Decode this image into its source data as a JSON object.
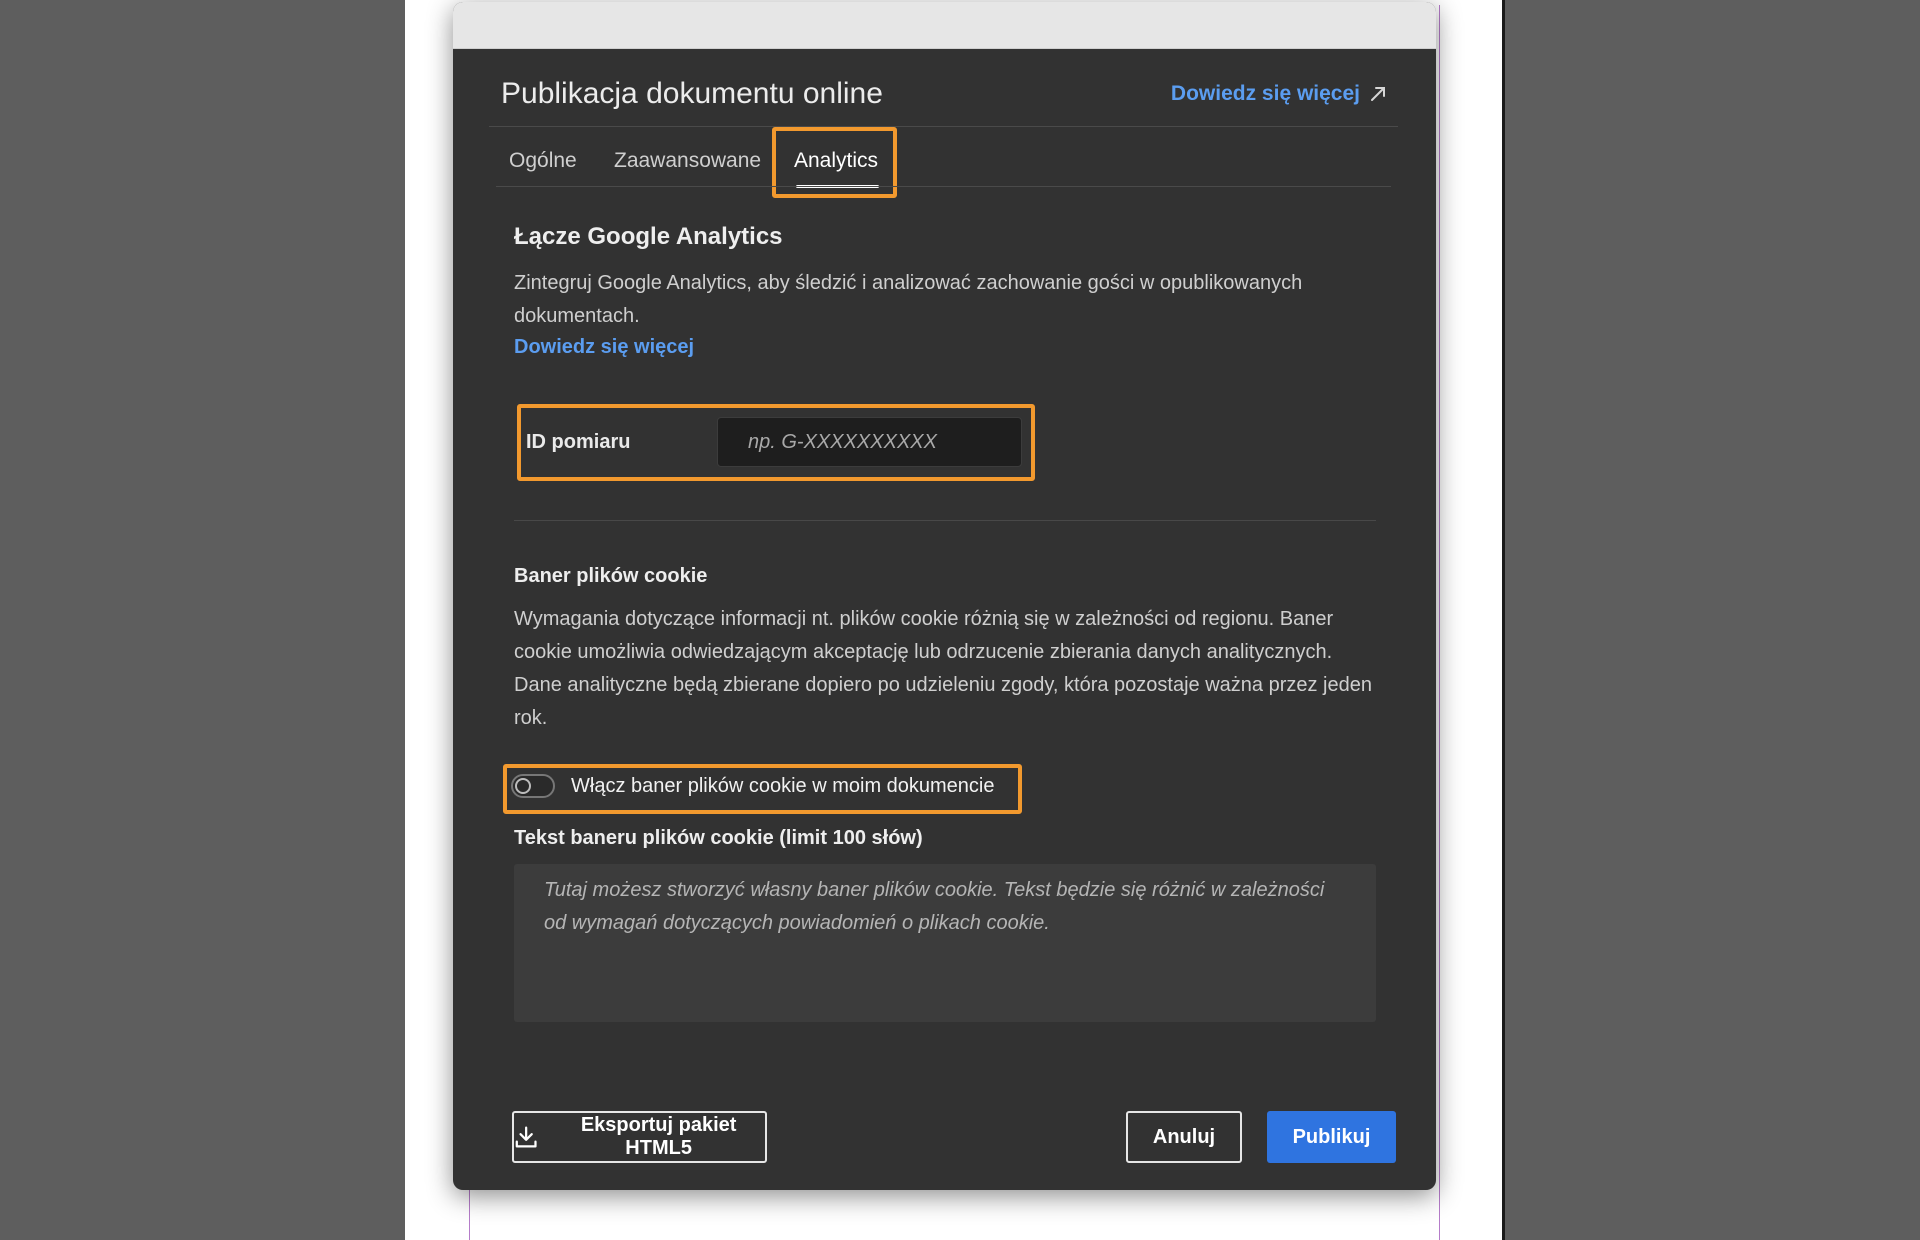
{
  "dialog": {
    "title": "Publikacja dokumentu online",
    "learn_more_top": "Dowiedz się więcej",
    "tabs": [
      {
        "label": "Ogólne",
        "active": false
      },
      {
        "label": "Zaawansowane",
        "active": false
      },
      {
        "label": "Analytics",
        "active": true
      }
    ]
  },
  "analytics": {
    "heading": "Łącze Google Analytics",
    "description": "Zintegruj Google Analytics, aby śledzić i analizować zachowanie gości w opublikowanych dokumentach.",
    "learn_more": "Dowiedz się więcej",
    "measurement_label": "ID pomiaru",
    "measurement_placeholder": "np. G-XXXXXXXXXX",
    "measurement_value": ""
  },
  "cookie": {
    "heading": "Baner plików cookie",
    "description": "Wymagania dotyczące informacji nt. plików cookie różnią się w zależności od regionu. Baner cookie umożliwia odwiedzającym akceptację lub odrzucenie zbierania danych analitycznych. Dane analityczne będą zbierane dopiero po udzieleniu zgody, która pozostaje ważna przez jeden rok.",
    "toggle_label": "Włącz baner plików cookie w moim dokumencie",
    "toggle_on": false,
    "text_label": "Tekst baneru plików cookie (limit 100 słów)",
    "text_placeholder": "Tutaj możesz stworzyć własny baner plików cookie. Tekst będzie się różnić w zależności od wymagań dotyczących powiadomień o plikach cookie."
  },
  "footer": {
    "export_label": "Eksportuj pakiet HTML5",
    "cancel_label": "Anuluj",
    "publish_label": "Publikuj"
  },
  "icons": {
    "learn_more": "external-link-icon",
    "export": "download-icon"
  },
  "colors": {
    "accent": "#2f74e0",
    "link": "#5b9df0",
    "highlight": "#f2992e",
    "dialog_bg": "#323232"
  }
}
